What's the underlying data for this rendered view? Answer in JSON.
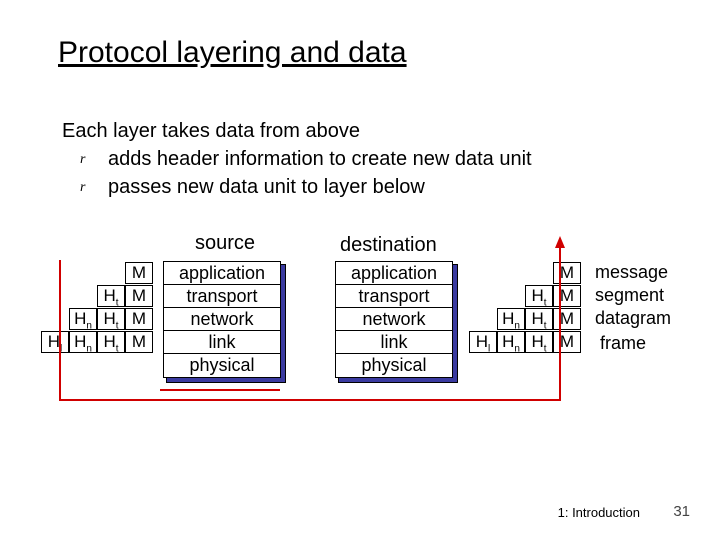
{
  "title": "Protocol layering and data",
  "intro": "Each layer takes data from above",
  "bullets": [
    "adds header information to create new data unit",
    "passes new data unit to layer below"
  ],
  "columns": {
    "left": "source",
    "right": "destination"
  },
  "layers": [
    "application",
    "transport",
    "network",
    "link",
    "physical"
  ],
  "headers": {
    "M": "M",
    "Ht": "H",
    "Hn": "H",
    "Hl": "H",
    "t": "t",
    "n": "n",
    "l": "l"
  },
  "pdu": [
    "message",
    "segment",
    "datagram",
    "frame"
  ],
  "footer": {
    "chapter": "1: Introduction",
    "page": "31"
  }
}
